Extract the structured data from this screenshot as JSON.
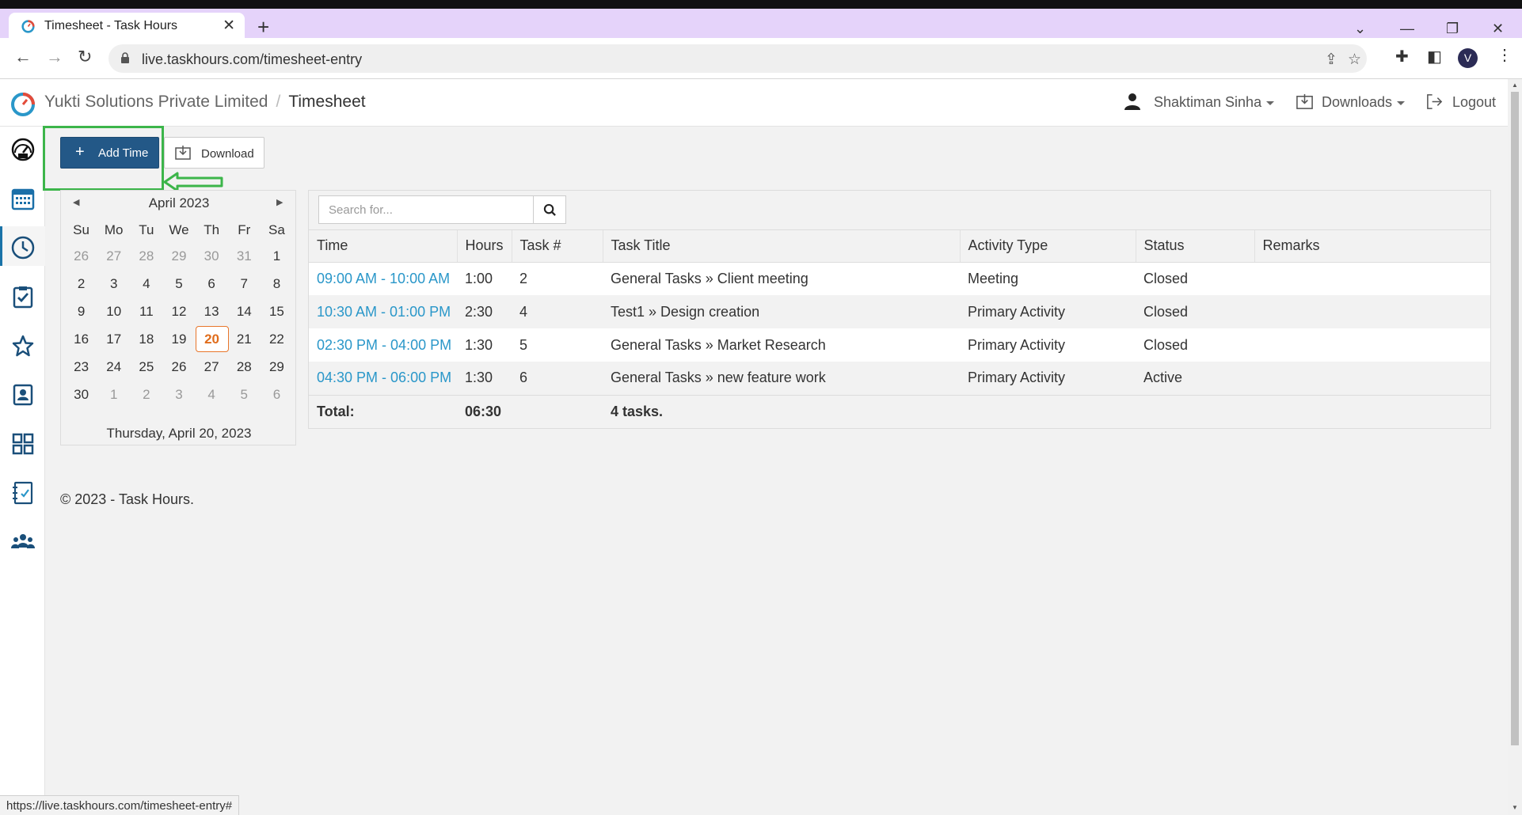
{
  "browser": {
    "tab_title": "Timesheet - Task Hours",
    "url": "live.taskhours.com/timesheet-entry",
    "avatar_letter": "V",
    "status_url": "https://live.taskhours.com/timesheet-entry#"
  },
  "header": {
    "company": "Yukti Solutions Private Limited",
    "separator": "/",
    "page": "Timesheet",
    "user": "Shaktiman Sinha",
    "downloads": "Downloads",
    "logout": "Logout"
  },
  "sidebar": {
    "items": [
      {
        "icon": "dashboard-gauge-icon"
      },
      {
        "icon": "calendar-icon"
      },
      {
        "icon": "clock-icon",
        "active": true
      },
      {
        "icon": "clipboard-check-icon"
      },
      {
        "icon": "star-icon"
      },
      {
        "icon": "contact-card-icon"
      },
      {
        "icon": "grid-icon"
      },
      {
        "icon": "checklist-icon"
      },
      {
        "icon": "team-icon"
      }
    ]
  },
  "toolbar": {
    "add_time": "Add Time",
    "download": "Download"
  },
  "calendar": {
    "month_title": "April 2023",
    "weekdays": [
      "Su",
      "Mo",
      "Tu",
      "We",
      "Th",
      "Fr",
      "Sa"
    ],
    "weeks": [
      [
        "26",
        "27",
        "28",
        "29",
        "30",
        "31",
        "1"
      ],
      [
        "2",
        "3",
        "4",
        "5",
        "6",
        "7",
        "8"
      ],
      [
        "9",
        "10",
        "11",
        "12",
        "13",
        "14",
        "15"
      ],
      [
        "16",
        "17",
        "18",
        "19",
        "20",
        "21",
        "22"
      ],
      [
        "23",
        "24",
        "25",
        "26",
        "27",
        "28",
        "29"
      ],
      [
        "30",
        "1",
        "2",
        "3",
        "4",
        "5",
        "6"
      ]
    ],
    "selected_day": "20",
    "footer": "Thursday, April 20, 2023"
  },
  "search": {
    "placeholder": "Search for..."
  },
  "table": {
    "headers": [
      "Time",
      "Hours",
      "Task #",
      "Task Title",
      "Activity Type",
      "Status",
      "Remarks"
    ],
    "rows": [
      {
        "time": "09:00 AM - 10:00 AM",
        "hours": "1:00",
        "task": "2",
        "title": "General Tasks » Client meeting",
        "activity": "Meeting",
        "status": "Closed",
        "remarks": ""
      },
      {
        "time": "10:30 AM - 01:00 PM",
        "hours": "2:30",
        "task": "4",
        "title": "Test1 » Design creation",
        "activity": "Primary Activity",
        "status": "Closed",
        "remarks": ""
      },
      {
        "time": "02:30 PM - 04:00 PM",
        "hours": "1:30",
        "task": "5",
        "title": "General Tasks » Market Research",
        "activity": "Primary Activity",
        "status": "Closed",
        "remarks": ""
      },
      {
        "time": "04:30 PM - 06:00 PM",
        "hours": "1:30",
        "task": "6",
        "title": "General Tasks » new feature work",
        "activity": "Primary Activity",
        "status": "Active",
        "remarks": ""
      }
    ],
    "total_label": "Total:",
    "total_hours": "06:30",
    "total_tasks": "4 tasks."
  },
  "footer": {
    "copyright": "© 2023 - Task Hours."
  },
  "colors": {
    "primary_button": "#235887",
    "link": "#2a97c9",
    "today_highlight": "#e06d1c",
    "annotation_green": "#3cb54a",
    "tabstrip": "#e5d3fa"
  }
}
